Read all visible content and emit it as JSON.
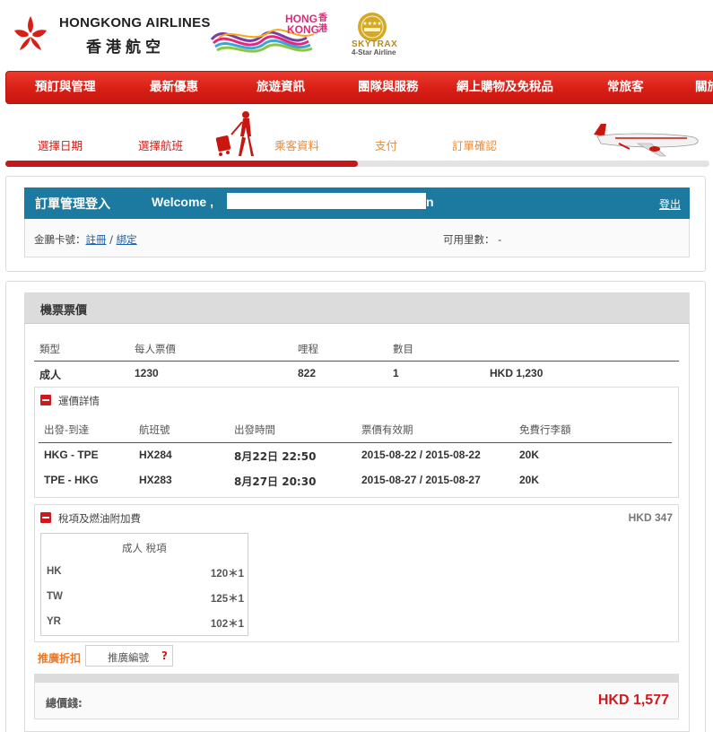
{
  "brand": {
    "name_en": "HONGKONG AIRLINES",
    "name_zh": "香港航空",
    "hk_brand_line1": "HONG",
    "hk_brand_line2": "KONG",
    "hk_brand_zh": "香港",
    "skytrax_line1": "SKYTRAX",
    "skytrax_line2": "4-Star Airline",
    "primary_red": "#d71f16",
    "accent_blue": "#1c7aa0"
  },
  "nav": {
    "items": [
      "預訂與管理",
      "最新優惠",
      "旅遊資訊",
      "團隊與服務",
      "網上購物及免稅品",
      "常旅客",
      "關於"
    ]
  },
  "steps": {
    "items": [
      "選擇日期",
      "選擇航班",
      "乘客資料",
      "支付",
      "訂單確認"
    ],
    "progress": 0.5
  },
  "login": {
    "title": "訂單管理登入",
    "welcome": "Welcome ,",
    "name_tail": "n",
    "logout": "登出",
    "card_label": "金鵬卡號：",
    "register": "註冊",
    "separator": "/",
    "bind": "綁定",
    "miles_label": "可用里數：",
    "miles_value": "-"
  },
  "fare": {
    "title": "機票票價",
    "columns": [
      "類型",
      "每人票價",
      "哩程",
      "數目"
    ],
    "row": {
      "type": "成人",
      "price": "1230",
      "miles": "822",
      "count": "1",
      "subtotal": "HKD 1,230"
    },
    "fare_details": {
      "title": "運價詳情",
      "columns": [
        "出發-到達",
        "航班號",
        "出發時間",
        "票價有效期",
        "免費行李額"
      ],
      "rows": [
        {
          "route": "HKG - TPE",
          "flight": "HX284",
          "time": "8月22日 22:50",
          "validity": "2015-08-22 / 2015-08-22",
          "baggage": "20K"
        },
        {
          "route": "TPE - HKG",
          "flight": "HX283",
          "time": "8月27日 20:30",
          "validity": "2015-08-27 / 2015-08-27",
          "baggage": "20K"
        }
      ]
    },
    "taxes": {
      "title": "稅項及燃油附加費",
      "total": "HKD 347",
      "box_title": "成人 稅項",
      "items": [
        {
          "code": "HK",
          "value": "120＊1"
        },
        {
          "code": "TW",
          "value": "125＊1"
        },
        {
          "code": "YR",
          "value": "102＊1"
        }
      ]
    },
    "promo": {
      "label": "推廣折扣",
      "placeholder": "推廣編號",
      "help": "?"
    },
    "total": {
      "label": "總價錢:",
      "value": "HKD 1,577"
    }
  }
}
